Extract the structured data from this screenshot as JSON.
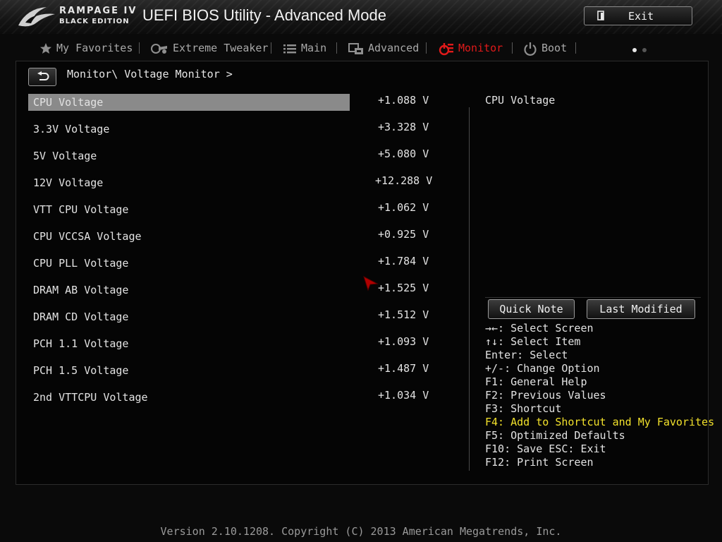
{
  "header": {
    "brand_line1": "RAMPAGE IV",
    "brand_line2": "BLACK EDITION",
    "title": "UEFI BIOS Utility - Advanced Mode",
    "exit_label": "Exit"
  },
  "tabs": [
    {
      "label": "My Favorites",
      "icon": "star-icon",
      "active": false
    },
    {
      "label": "Extreme Tweaker",
      "icon": "tweaker-icon",
      "active": false
    },
    {
      "label": "Main",
      "icon": "list-icon",
      "active": false
    },
    {
      "label": "Advanced",
      "icon": "advanced-icon",
      "active": false
    },
    {
      "label": "Monitor",
      "icon": "monitor-icon",
      "active": true
    },
    {
      "label": "Boot",
      "icon": "power-icon",
      "active": false
    }
  ],
  "breadcrumb": "Monitor\\ Voltage Monitor >",
  "voltages": [
    {
      "name": "CPU Voltage",
      "value": "+1.088 V"
    },
    {
      "name": "3.3V Voltage",
      "value": "+3.328 V"
    },
    {
      "name": "5V Voltage",
      "value": "+5.080 V"
    },
    {
      "name": "12V Voltage",
      "value": "+12.288 V"
    },
    {
      "name": "VTT CPU Voltage",
      "value": "+1.062 V"
    },
    {
      "name": "CPU VCCSA Voltage",
      "value": "+0.925 V"
    },
    {
      "name": "CPU PLL Voltage",
      "value": "+1.784 V"
    },
    {
      "name": "DRAM AB Voltage",
      "value": "+1.525 V"
    },
    {
      "name": "DRAM CD Voltage",
      "value": "+1.512 V"
    },
    {
      "name": "PCH 1.1 Voltage",
      "value": "+1.093 V"
    },
    {
      "name": "PCH 1.5 Voltage",
      "value": "+1.487 V"
    },
    {
      "name": "2nd VTTCPU Voltage",
      "value": "+1.034 V"
    }
  ],
  "help": {
    "title": "CPU Voltage",
    "quick_note": "Quick Note",
    "last_modified": "Last Modified",
    "keys": [
      "→←: Select Screen",
      "↑↓: Select Item",
      "Enter: Select",
      "+/-: Change Option",
      "F1: General Help",
      "F2: Previous Values",
      "F3: Shortcut",
      "F4: Add to Shortcut and My Favorites",
      "F5: Optimized Defaults",
      "F10: Save  ESC: Exit",
      "F12: Print Screen"
    ]
  },
  "footer": "Version 2.10.1208. Copyright (C) 2013 American Megatrends, Inc.",
  "colors": {
    "accent": "#e11a1a",
    "highlight_key": "#f2e12b",
    "selection": "#8a8a8a"
  }
}
